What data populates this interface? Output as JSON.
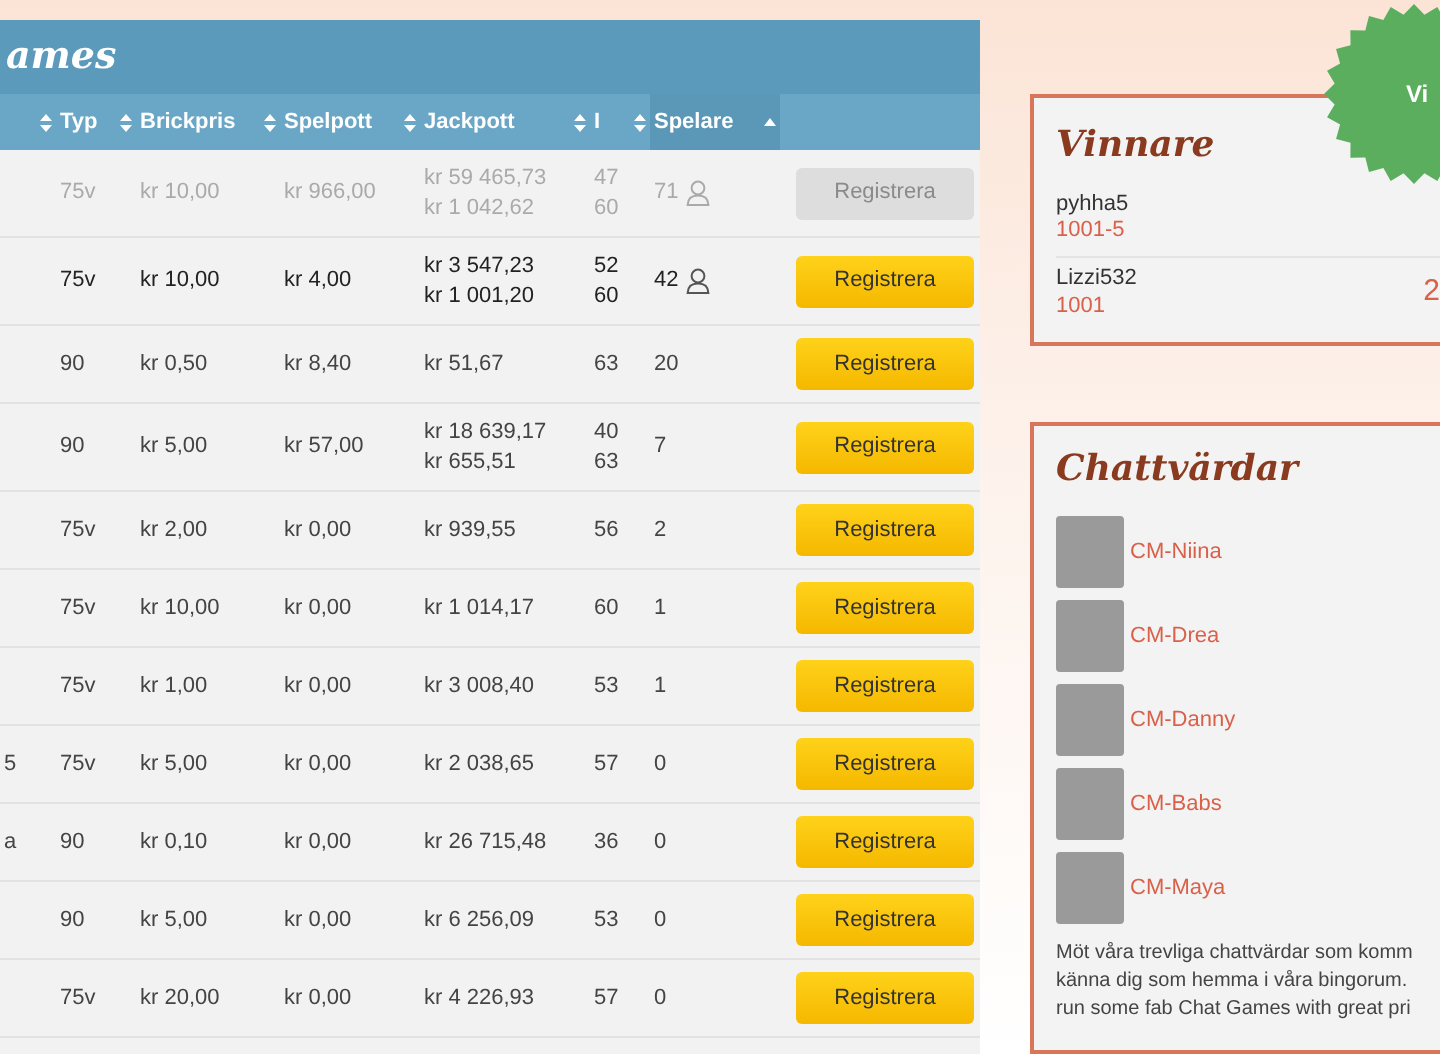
{
  "games_panel": {
    "title": "ames",
    "columns": [
      {},
      {
        "label": "Typ"
      },
      {
        "label": "Brickpris"
      },
      {
        "label": "Spelpott"
      },
      {
        "label": "Jackpott"
      },
      {
        "label": "I"
      },
      {
        "label": "Spelare",
        "sorted": true
      },
      {}
    ],
    "rows": [
      {
        "typ": "75v",
        "brickpris": "kr 10,00",
        "spelpott": "kr 966,00",
        "jackpott": [
          "kr 59 465,73",
          "kr 1 042,62"
        ],
        "i": [
          "47",
          "60"
        ],
        "spelare": "71",
        "player_icon": true,
        "button": "Registrera",
        "disabled": true,
        "bold": false
      },
      {
        "typ": "75v",
        "brickpris": "kr 10,00",
        "spelpott": "kr 4,00",
        "jackpott": [
          "kr 3 547,23",
          "kr 1 001,20"
        ],
        "i": [
          "52",
          "60"
        ],
        "spelare": "42",
        "player_icon": true,
        "button": "Registrera",
        "disabled": false,
        "bold": true
      },
      {
        "typ": "90",
        "brickpris": "kr 0,50",
        "spelpott": "kr 8,40",
        "jackpott": [
          "kr 51,67"
        ],
        "i": [
          "63"
        ],
        "spelare": "20",
        "player_icon": false,
        "button": "Registrera",
        "disabled": false,
        "bold": false
      },
      {
        "typ": "90",
        "brickpris": "kr 5,00",
        "spelpott": "kr 57,00",
        "jackpott": [
          "kr 18 639,17",
          "kr 655,51"
        ],
        "i": [
          "40",
          "63"
        ],
        "spelare": "7",
        "player_icon": false,
        "button": "Registrera",
        "disabled": false,
        "bold": false
      },
      {
        "typ": "75v",
        "brickpris": "kr 2,00",
        "spelpott": "kr 0,00",
        "jackpott": [
          "kr 939,55"
        ],
        "i": [
          "56"
        ],
        "spelare": "2",
        "player_icon": false,
        "button": "Registrera",
        "disabled": false,
        "bold": false
      },
      {
        "typ": "75v",
        "brickpris": "kr 10,00",
        "spelpott": "kr 0,00",
        "jackpott": [
          "kr 1 014,17"
        ],
        "i": [
          "60"
        ],
        "spelare": "1",
        "player_icon": false,
        "button": "Registrera",
        "disabled": false,
        "bold": false
      },
      {
        "typ": "75v",
        "brickpris": "kr 1,00",
        "spelpott": "kr 0,00",
        "jackpott": [
          "kr 3 008,40"
        ],
        "i": [
          "53"
        ],
        "spelare": "1",
        "player_icon": false,
        "button": "Registrera",
        "disabled": false,
        "bold": false
      },
      {
        "column_1": "5",
        "typ": "75v",
        "brickpris": "kr 5,00",
        "spelpott": "kr 0,00",
        "jackpott": [
          "kr 2 038,65"
        ],
        "i": [
          "57"
        ],
        "spelare": "0",
        "player_icon": false,
        "button": "Registrera",
        "disabled": false,
        "bold": false
      },
      {
        "column_1": "a",
        "typ": "90",
        "brickpris": "kr 0,10",
        "spelpott": "kr 0,00",
        "jackpott": [
          "kr 26 715,48"
        ],
        "i": [
          "36"
        ],
        "spelare": "0",
        "player_icon": false,
        "button": "Registrera",
        "disabled": false,
        "bold": false
      },
      {
        "typ": "90",
        "brickpris": "kr 5,00",
        "spelpott": "kr 0,00",
        "jackpott": [
          "kr 6 256,09"
        ],
        "i": [
          "53"
        ],
        "spelare": "0",
        "player_icon": false,
        "button": "Registrera",
        "disabled": false,
        "bold": false
      },
      {
        "typ": "75v",
        "brickpris": "kr 20,00",
        "spelpott": "kr 0,00",
        "jackpott": [
          "kr 4 226,93"
        ],
        "i": [
          "57"
        ],
        "spelare": "0",
        "player_icon": false,
        "button": "Registrera",
        "disabled": false,
        "bold": false
      }
    ]
  },
  "badge": {
    "text": "Vi"
  },
  "winners": {
    "title": "Vinnare",
    "items": [
      {
        "name": "pyhha5",
        "number": "1001-5"
      },
      {
        "name": "Lizzi532",
        "number": "1001",
        "amount": "2"
      }
    ]
  },
  "hosts": {
    "title": "Chattvärdar",
    "items": [
      {
        "name": "CM-Niina"
      },
      {
        "name": "CM-Drea"
      },
      {
        "name": "CM-Danny"
      },
      {
        "name": "CM-Babs"
      },
      {
        "name": "CM-Maya"
      }
    ],
    "description": [
      "Möt våra trevliga chattvärdar som komm",
      "känna dig som hemma i våra bingorum.",
      "run some fab Chat Games with great pri"
    ]
  }
}
